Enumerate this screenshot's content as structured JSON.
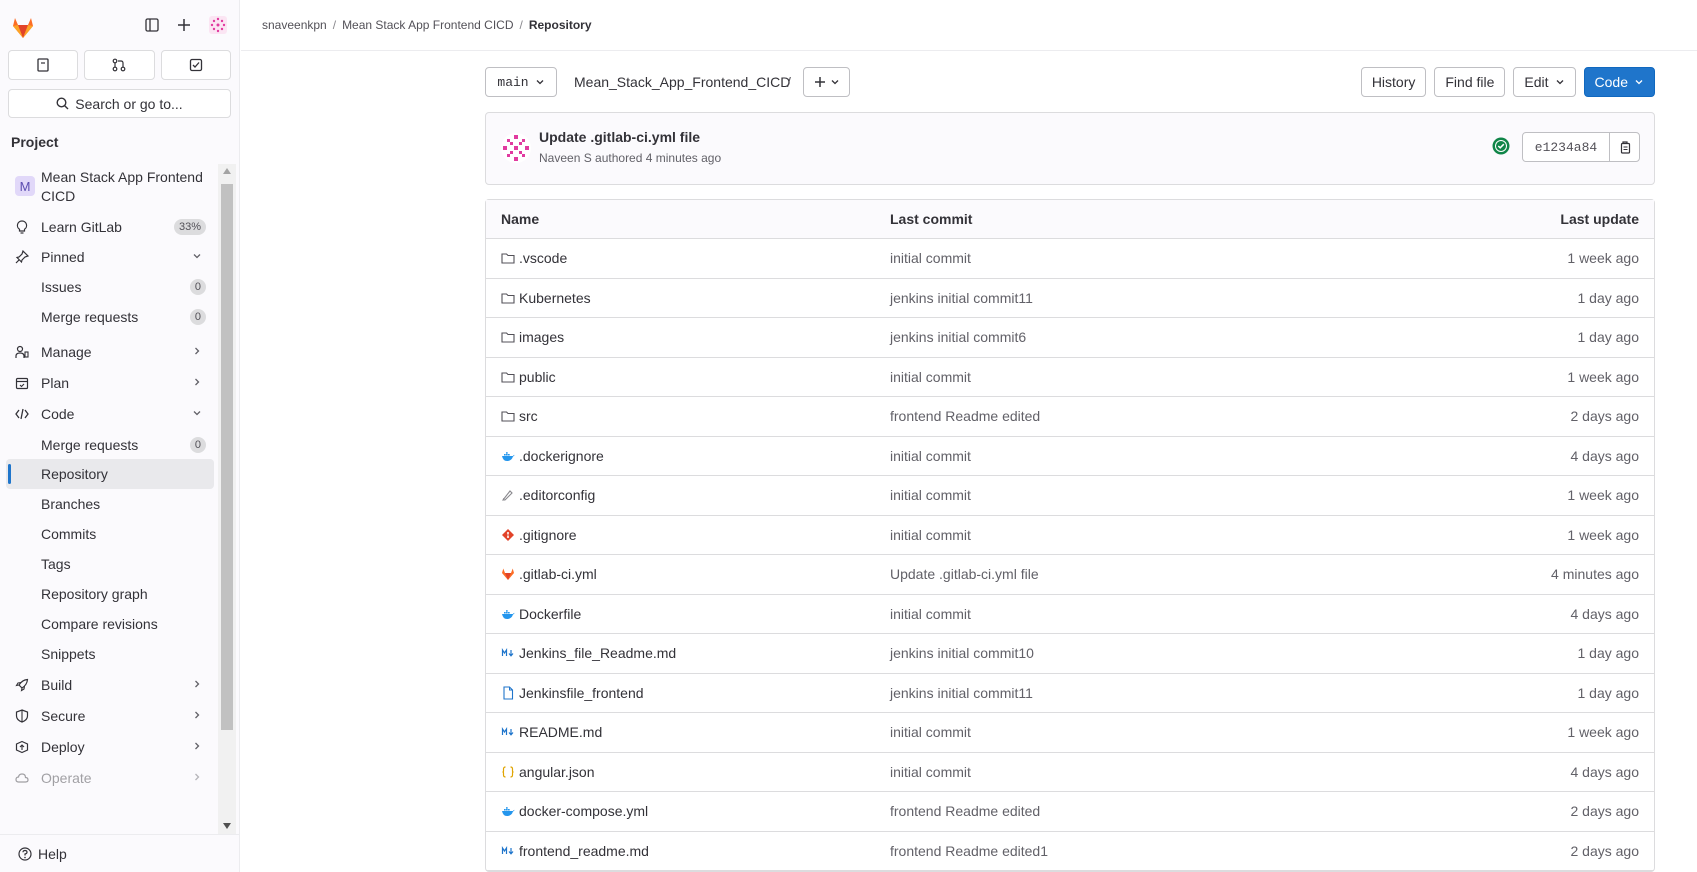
{
  "breadcrumb": {
    "items": [
      "snaveenkpn",
      "Mean Stack App Frontend CICD"
    ],
    "current": "Repository",
    "separator": "/"
  },
  "sidebar": {
    "search_label": "Search or go to...",
    "section_title": "Project",
    "project_name_line1": "Mean Stack App Frontend",
    "project_name_line2": "CICD",
    "project_initial": "M",
    "learn_label": "Learn GitLab",
    "learn_progress": "33%",
    "pinned_label": "Pinned",
    "pinned_issues_label": "Issues",
    "pinned_issues_count": "0",
    "pinned_mr_label": "Merge requests",
    "pinned_mr_count": "0",
    "manage_label": "Manage",
    "plan_label": "Plan",
    "code_label": "Code",
    "code_items": {
      "merge_requests": "Merge requests",
      "merge_requests_count": "0",
      "repository": "Repository",
      "branches": "Branches",
      "commits": "Commits",
      "tags": "Tags",
      "repository_graph": "Repository graph",
      "compare_revisions": "Compare revisions",
      "snippets": "Snippets"
    },
    "build_label": "Build",
    "secure_label": "Secure",
    "deploy_label": "Deploy",
    "operate_label": "Operate",
    "help_label": "Help"
  },
  "toolbar": {
    "branch": "main",
    "path": "Mean_Stack_App_Frontend_CICD",
    "path_sep": "/",
    "history": "History",
    "find_file": "Find file",
    "edit": "Edit",
    "code": "Code"
  },
  "last_commit": {
    "title": "Update .gitlab-ci.yml file",
    "meta": "Naveen S authored 4 minutes ago",
    "sha": "e1234a84"
  },
  "table": {
    "headers": {
      "name": "Name",
      "last_commit": "Last commit",
      "last_update": "Last update"
    },
    "rows": [
      {
        "name": ".vscode",
        "commit": "initial commit",
        "updated": "1 week ago",
        "icon": "folder-icon"
      },
      {
        "name": "Kubernetes",
        "commit": "jenkins initial commit11",
        "updated": "1 day ago",
        "icon": "folder-icon"
      },
      {
        "name": "images",
        "commit": "jenkins initial commit6",
        "updated": "1 day ago",
        "icon": "folder-icon"
      },
      {
        "name": "public",
        "commit": "initial commit",
        "updated": "1 week ago",
        "icon": "folder-icon"
      },
      {
        "name": "src",
        "commit": "frontend Readme edited",
        "updated": "2 days ago",
        "icon": "folder-icon"
      },
      {
        "name": ".dockerignore",
        "commit": "initial commit",
        "updated": "4 days ago",
        "icon": "docker-icon"
      },
      {
        "name": ".editorconfig",
        "commit": "initial commit",
        "updated": "1 week ago",
        "icon": "editorconfig-icon"
      },
      {
        "name": ".gitignore",
        "commit": "initial commit",
        "updated": "1 week ago",
        "icon": "git-icon"
      },
      {
        "name": ".gitlab-ci.yml",
        "commit": "Update .gitlab-ci.yml file",
        "updated": "4 minutes ago",
        "icon": "gitlab-icon"
      },
      {
        "name": "Dockerfile",
        "commit": "initial commit",
        "updated": "4 days ago",
        "icon": "docker-icon"
      },
      {
        "name": "Jenkins_file_Readme.md",
        "commit": "jenkins initial commit10",
        "updated": "1 day ago",
        "icon": "markdown-icon"
      },
      {
        "name": "Jenkinsfile_frontend",
        "commit": "jenkins initial commit11",
        "updated": "1 day ago",
        "icon": "file-icon"
      },
      {
        "name": "README.md",
        "commit": "initial commit",
        "updated": "1 week ago",
        "icon": "markdown-icon"
      },
      {
        "name": "angular.json",
        "commit": "initial commit",
        "updated": "4 days ago",
        "icon": "json-icon"
      },
      {
        "name": "docker-compose.yml",
        "commit": "frontend Readme edited",
        "updated": "2 days ago",
        "icon": "docker-icon"
      },
      {
        "name": "frontend_readme.md",
        "commit": "frontend Readme edited1",
        "updated": "2 days ago",
        "icon": "markdown-icon"
      }
    ]
  },
  "colors": {
    "primary": "#1f75cb",
    "success": "#108548",
    "gitlab_orange": "#e24329"
  }
}
